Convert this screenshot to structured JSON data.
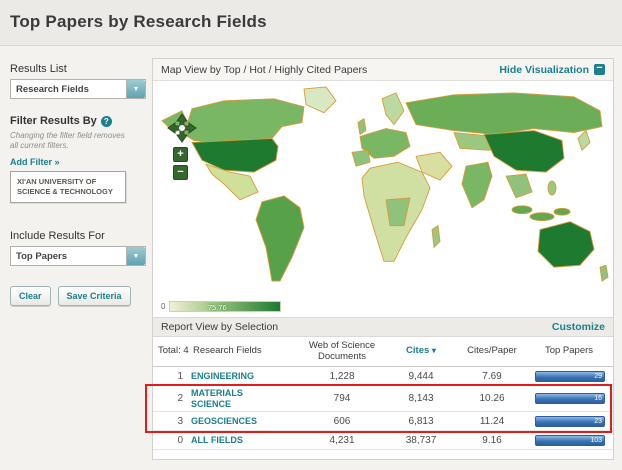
{
  "page": {
    "title": "Top Papers by Research Fields"
  },
  "colors": {
    "accent_teal": "#1b7f8e",
    "map_green_dark": "#1d7a2f",
    "bar_blue": "#3a74b6",
    "highlight_red": "#e01c1c"
  },
  "icons": {
    "dropdown_arrow": "▼",
    "help": "?",
    "minus": "−",
    "plus": "+",
    "sort_down": "▾"
  },
  "sidebar": {
    "results_list_label": "Results List",
    "results_list_value": "Research Fields",
    "filter_by_label": "Filter Results By",
    "filter_note": "Changing the filter field removes all current filters.",
    "add_filter_label": "Add Filter »",
    "filter_value": "XI'AN UNIVERSITY OF SCIENCE & TECHNOLOGY",
    "include_results_label": "Include Results For",
    "include_results_value": "Top Papers",
    "clear_label": "Clear",
    "save_label": "Save Criteria"
  },
  "map": {
    "header": "Map View by Top / Hot / Highly Cited Papers",
    "hide_label": "Hide Visualization",
    "scale_min": "0",
    "scale_max": "75.76"
  },
  "report": {
    "header": "Report View by Selection",
    "customize_label": "Customize",
    "total_label": "Total: 4",
    "columns": [
      "Research Fields",
      "Web of Science Documents",
      "Cites",
      "Cites/Paper",
      "Top Papers"
    ],
    "rows": [
      {
        "rank": "1",
        "field": "ENGINEERING",
        "docs": "1,228",
        "cites": "9,444",
        "cites_per_paper": "7.69",
        "top_papers": "29"
      },
      {
        "rank": "2",
        "field": "MATERIALS SCIENCE",
        "docs": "794",
        "cites": "8,143",
        "cites_per_paper": "10.26",
        "top_papers": "16"
      },
      {
        "rank": "3",
        "field": "GEOSCIENCES",
        "docs": "606",
        "cites": "6,813",
        "cites_per_paper": "11.24",
        "top_papers": "23"
      },
      {
        "rank": "0",
        "field": "ALL FIELDS",
        "docs": "4,231",
        "cites": "38,737",
        "cites_per_paper": "9.16",
        "top_papers": "103"
      }
    ]
  }
}
